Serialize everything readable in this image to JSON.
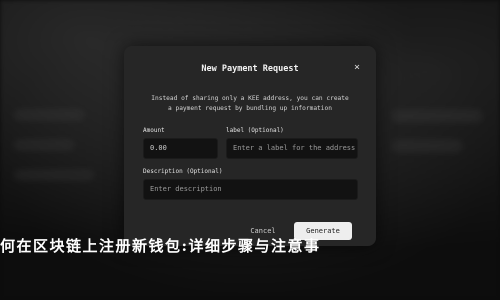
{
  "dialog": {
    "title": "New Payment Request",
    "description_line1": "Instead of sharing only a KEE address, you can create",
    "description_line2": "a payment request by bundling up information",
    "close_icon": "×",
    "amount": {
      "label": "Amount",
      "value": "0.00"
    },
    "label_field": {
      "label": "label (Optional)",
      "placeholder": "Enter a label for the address"
    },
    "description_field": {
      "label": "Description (Optional)",
      "placeholder": "Enter description"
    },
    "cancel_label": "Cancel",
    "generate_label": "Generate"
  },
  "headline": "何在区块链上注册新钱包:详细步骤与注意事"
}
